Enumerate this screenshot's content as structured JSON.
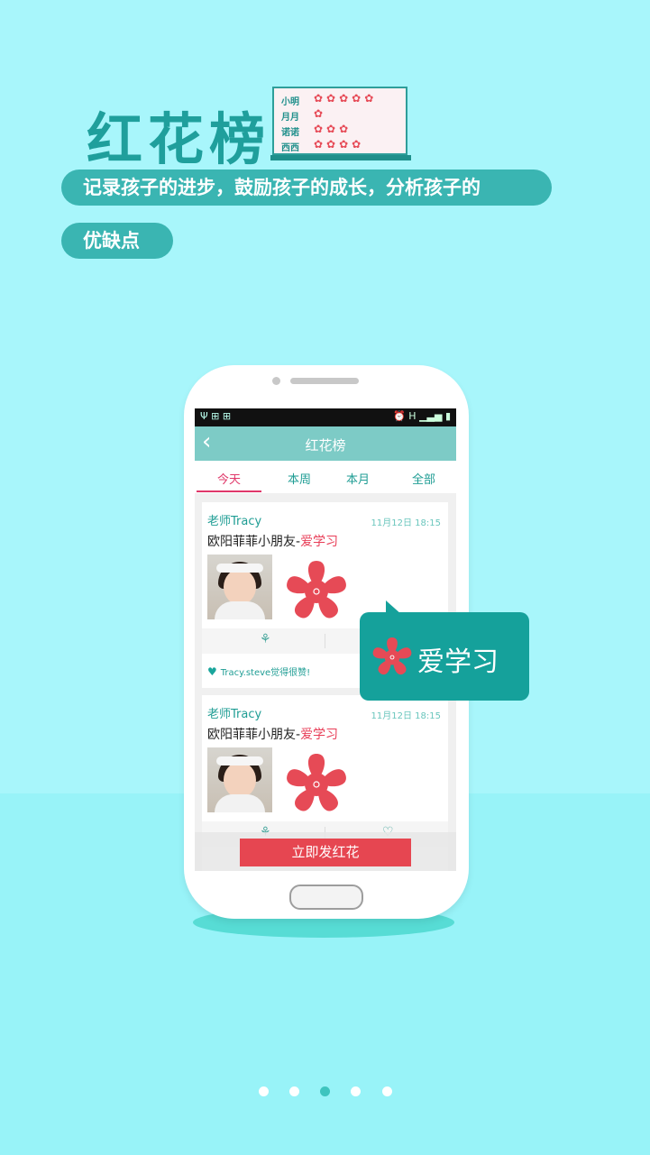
{
  "header": {
    "title": "红花榜",
    "board_rows": [
      {
        "name": "小明",
        "flowers": 5
      },
      {
        "name": "月月",
        "flowers": 1
      },
      {
        "name": "诺诺",
        "flowers": 3
      },
      {
        "name": "西西",
        "flowers": 4
      }
    ],
    "tagline_line1": "记录孩子的进步，鼓励孩子的成长，分析孩子的",
    "tagline_line2": "优缺点"
  },
  "status_bar": {
    "left_icons": "Ψ ⊞ ⊞",
    "right_icons": "⏰ H ▁▃▅ ▮"
  },
  "app": {
    "title": "红花榜",
    "back_icon": "chevron-left-icon",
    "tabs": [
      {
        "label": "今天",
        "active": true
      },
      {
        "label": "本周",
        "active": false
      },
      {
        "label": "本月",
        "active": false
      },
      {
        "label": "全部",
        "active": false
      }
    ],
    "posts": [
      {
        "teacher": "老师Tracy",
        "time": "11月12日  18:15",
        "message_prefix": "欧阳菲菲小朋友-",
        "message_highlight": "爱学习",
        "likes_text": "Tracy.steve觉得很赞!"
      },
      {
        "teacher": "老师Tracy",
        "time": "11月12日  18:15",
        "message_prefix": "欧阳菲菲小朋友-",
        "message_highlight": "爱学习",
        "likes_text": ""
      }
    ],
    "send_button": "立即发红花"
  },
  "callout": {
    "text": "爱学习"
  },
  "pager": {
    "count": 5,
    "active_index": 2
  },
  "colors": {
    "accent": "#1f9f9c",
    "flower_red": "#e64a56",
    "tab_active": "#e0386a"
  }
}
